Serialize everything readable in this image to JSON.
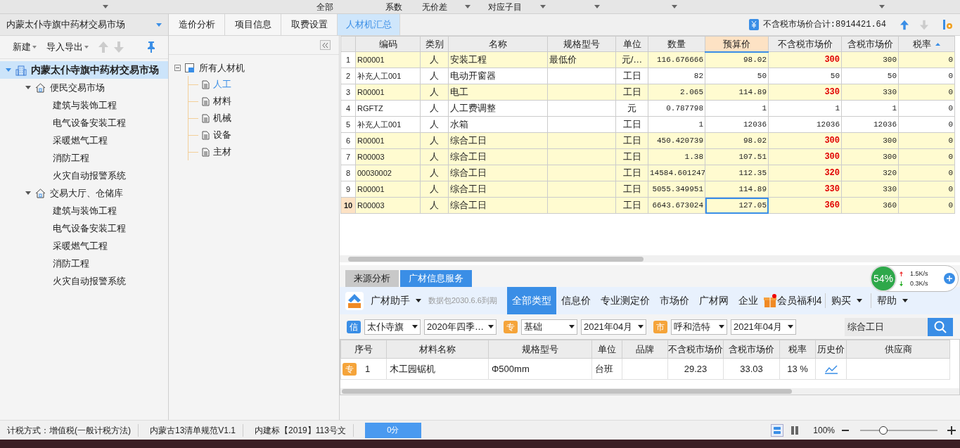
{
  "top_bar": {
    "filters": [
      {
        "label": "全部"
      },
      {
        "label": "系数"
      },
      {
        "label": "无价差"
      },
      {
        "label": "对应子目"
      }
    ]
  },
  "project_selector": {
    "value": "内蒙太仆寺旗中药材交易市场"
  },
  "left_toolbar": {
    "menus": [
      "新建",
      "导入导出"
    ]
  },
  "project_tree": [
    {
      "label": "内蒙太仆寺旗中药材交易市场",
      "kind": "project",
      "selected": true,
      "expanded": true,
      "children": [
        {
          "label": "便民交易市场",
          "kind": "unit",
          "selected": false,
          "expanded": true,
          "children": [
            {
              "label": "建筑与装饰工程",
              "kind": "item",
              "selected": false
            },
            {
              "label": "电气设备安装工程",
              "kind": "item",
              "selected": false
            },
            {
              "label": "采暖燃气工程",
              "kind": "item",
              "selected": false
            },
            {
              "label": "消防工程",
              "kind": "item",
              "selected": false
            },
            {
              "label": "火灾自动报警系统",
              "kind": "item",
              "selected": false
            }
          ]
        },
        {
          "label": "交易大厅、仓储库",
          "kind": "unit",
          "selected": false,
          "expanded": true,
          "children": [
            {
              "label": "建筑与装饰工程",
              "kind": "item",
              "selected": false
            },
            {
              "label": "电气设备安装工程",
              "kind": "item",
              "selected": false
            },
            {
              "label": "采暖燃气工程",
              "kind": "item",
              "selected": false
            },
            {
              "label": "消防工程",
              "kind": "item",
              "selected": false
            },
            {
              "label": "火灾自动报警系统",
              "kind": "item",
              "selected": false
            }
          ]
        }
      ]
    }
  ],
  "tabs": [
    {
      "label": "造价分析",
      "selected": false
    },
    {
      "label": "项目信息",
      "selected": false
    },
    {
      "label": "取费设置",
      "selected": false
    },
    {
      "label": "人材机汇总",
      "selected": true
    }
  ],
  "total": "不含税市场价合计:8914421.64",
  "category_tree": {
    "label": "所有人材机",
    "expanded": true,
    "children": [
      {
        "label": "人工",
        "selected": true
      },
      {
        "label": "材料",
        "selected": false
      },
      {
        "label": "机械",
        "selected": false
      },
      {
        "label": "设备",
        "selected": false
      },
      {
        "label": "主材",
        "selected": false
      }
    ]
  },
  "table": {
    "columns": [
      {
        "label": "编码",
        "highlighted": false
      },
      {
        "label": "类别",
        "highlighted": false
      },
      {
        "label": "名称",
        "highlighted": false
      },
      {
        "label": "规格型号",
        "highlighted": false
      },
      {
        "label": "单位",
        "highlighted": false
      },
      {
        "label": "数量",
        "highlighted": false
      },
      {
        "label": "预算价",
        "highlighted": true
      },
      {
        "label": "不含税市场价",
        "highlighted": false
      },
      {
        "label": "含税市场价",
        "highlighted": false
      },
      {
        "label": "税率",
        "highlighted": false
      }
    ],
    "rows": [
      {
        "no": "1",
        "highlighted": true,
        "price_changed": true,
        "selected": false,
        "cells": [
          "R00001",
          "人",
          "安装工程",
          "最低价",
          "元/…",
          "116.676666",
          "98.02",
          "300",
          "300",
          "0"
        ]
      },
      {
        "no": "2",
        "highlighted": false,
        "price_changed": false,
        "selected": false,
        "cells": [
          "补充人工001",
          "人",
          "电动开窗器",
          "",
          "工日",
          "82",
          "50",
          "50",
          "50",
          "0"
        ]
      },
      {
        "no": "3",
        "highlighted": true,
        "price_changed": true,
        "selected": false,
        "cells": [
          "R00001",
          "人",
          "电工",
          "",
          "工日",
          "2.065",
          "114.89",
          "330",
          "330",
          "0"
        ]
      },
      {
        "no": "4",
        "highlighted": false,
        "price_changed": false,
        "selected": false,
        "cells": [
          "RGFTZ",
          "人",
          "人工费调整",
          "",
          "元",
          "0.787798",
          "1",
          "1",
          "1",
          "0"
        ]
      },
      {
        "no": "5",
        "highlighted": false,
        "price_changed": false,
        "selected": false,
        "cells": [
          "补充人工001",
          "人",
          "水箱",
          "",
          "工日",
          "1",
          "12036",
          "12036",
          "12036",
          "0"
        ]
      },
      {
        "no": "6",
        "highlighted": true,
        "price_changed": true,
        "selected": false,
        "cells": [
          "R00001",
          "人",
          "综合工日",
          "",
          "工日",
          "450.420739",
          "98.02",
          "300",
          "300",
          "0"
        ]
      },
      {
        "no": "7",
        "highlighted": true,
        "price_changed": true,
        "selected": false,
        "cells": [
          "R00003",
          "人",
          "综合工日",
          "",
          "工日",
          "1.38",
          "107.51",
          "300",
          "300",
          "0"
        ]
      },
      {
        "no": "8",
        "highlighted": true,
        "price_changed": true,
        "selected": false,
        "cells": [
          "00030002",
          "人",
          "综合工日",
          "",
          "工日",
          "14584.601247",
          "112.35",
          "320",
          "320",
          "0"
        ]
      },
      {
        "no": "9",
        "highlighted": true,
        "price_changed": true,
        "selected": false,
        "cells": [
          "R00001",
          "人",
          "综合工日",
          "",
          "工日",
          "5055.349951",
          "114.89",
          "330",
          "330",
          "0"
        ]
      },
      {
        "no": "10",
        "highlighted": true,
        "price_changed": true,
        "selected": true,
        "cells": [
          "R00003",
          "人",
          "综合工日",
          "",
          "工日",
          "6643.673024",
          "127.05",
          "360",
          "360",
          "0"
        ]
      }
    ]
  },
  "bottom_tabs": [
    {
      "label": "来源分析",
      "selected": false
    },
    {
      "label": "广材信息服务",
      "selected": true
    }
  ],
  "service_bar": {
    "brand": "广材助手",
    "expiry": "数据包2030.6.6到期",
    "nav": [
      {
        "label": "全部类型",
        "selected": true
      },
      {
        "label": "信息价",
        "selected": false
      },
      {
        "label": "专业测定价",
        "selected": false
      },
      {
        "label": "市场价",
        "selected": false
      },
      {
        "label": "广材网",
        "selected": false
      },
      {
        "label": "企业",
        "selected": false
      }
    ],
    "gift": "会员福利4",
    "menus": [
      "购买",
      "帮助"
    ]
  },
  "filters": [
    {
      "badge": "信",
      "selects": [
        "太仆寺旗",
        "2020年四季…"
      ]
    },
    {
      "badge": "专",
      "selects": [
        "基础",
        "2021年04月"
      ]
    },
    {
      "badge": "市",
      "selects": [
        "呼和浩特",
        "2021年04月"
      ]
    }
  ],
  "search": {
    "value": "综合工日"
  },
  "price_table": {
    "columns": [
      "序号",
      "材料名称",
      "规格型号",
      "单位",
      "品牌",
      "不含税市场价",
      "含税市场价",
      "税率",
      "历史价",
      "供应商"
    ],
    "rows": [
      {
        "badge": "专",
        "cells": [
          "1",
          "木工园锯机",
          "Φ500mm",
          "台班",
          "",
          "29.23",
          "33.03",
          "13 %"
        ]
      }
    ]
  },
  "network": {
    "percent": "54%",
    "up": "1.5K/s",
    "down": "0.3K/s"
  },
  "status_bar": {
    "items": [
      "计税方式：增值税(一般计税方法)",
      "内蒙古13清单规范V1.1",
      "内建标【2019】113号文"
    ],
    "score": "0分",
    "zoom": "100%",
    "zoom_slider": {
      "level": 0.3
    }
  }
}
